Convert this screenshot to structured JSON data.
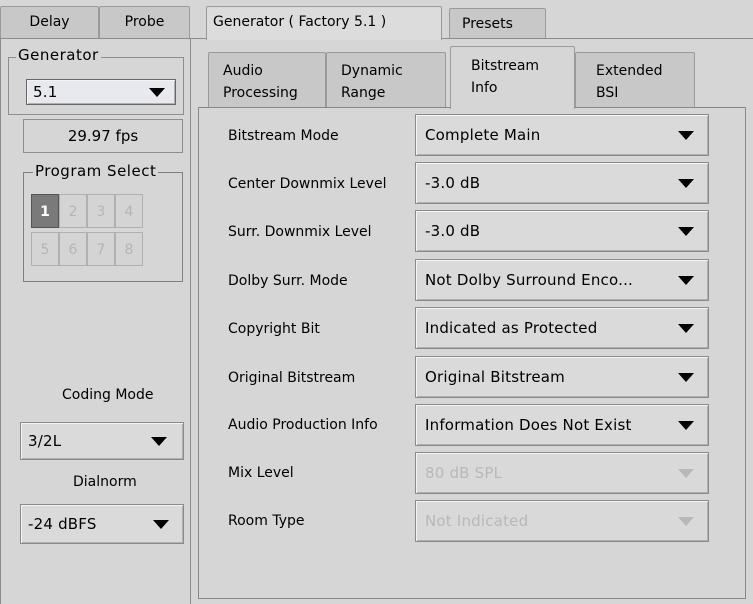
{
  "top_tabs": [
    "Delay",
    "Probe",
    "Generator ( Factory 5.1 )",
    "Presets"
  ],
  "sub_tabs": [
    {
      "line1": "Audio",
      "line2": "Processing"
    },
    {
      "line1": "Dynamic",
      "line2": "Range"
    },
    {
      "line1": "Bitstream",
      "line2": "Info"
    },
    {
      "line1": "Extended",
      "line2": "BSI"
    }
  ],
  "left": {
    "generator_legend": "Generator",
    "generator_value": "5.1",
    "fps": "29.97 fps",
    "program_select_legend": "Program Select",
    "programs": [
      "1",
      "2",
      "3",
      "4",
      "5",
      "6",
      "7",
      "8"
    ],
    "selected_program": "1",
    "coding_mode_label": "Coding Mode",
    "coding_mode_value": "3/2L",
    "dialnorm_label": "Dialnorm",
    "dialnorm_value": "-24 dBFS"
  },
  "rows": [
    {
      "label": "Bitstream Mode",
      "value": "Complete Main",
      "enabled": true
    },
    {
      "label": "Center Downmix Level",
      "value": "-3.0 dB",
      "enabled": true
    },
    {
      "label": "Surr. Downmix Level",
      "value": "-3.0 dB",
      "enabled": true
    },
    {
      "label": "Dolby Surr. Mode",
      "value": "Not Dolby Surround Enco...",
      "enabled": true
    },
    {
      "label": "Copyright Bit",
      "value": "Indicated as Protected",
      "enabled": true
    },
    {
      "label": "Original Bitstream",
      "value": "Original Bitstream",
      "enabled": true
    },
    {
      "label": "Audio Production Info",
      "value": "Information Does Not Exist",
      "enabled": true
    },
    {
      "label": "Mix Level",
      "value": "80 dB SPL",
      "enabled": false
    },
    {
      "label": "Room Type",
      "value": "Not Indicated",
      "enabled": false
    }
  ]
}
